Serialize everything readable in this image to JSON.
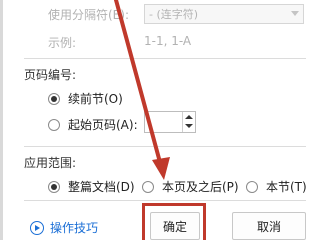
{
  "separator_setting": {
    "label": "使用分隔符(E):",
    "value": "- (连字符)",
    "example_label": "示例:",
    "example_value": "1-1, 1-A"
  },
  "page_numbering": {
    "title": "页码编号:",
    "continue_label": "续前节(O)",
    "start_label": "起始页码(A):",
    "start_value": "",
    "selected": "continue"
  },
  "apply_scope": {
    "title": "应用范围:",
    "options": [
      "整篇文档(D)",
      "本页及之后(P)",
      "本节(T)"
    ],
    "selected": "整篇文档(D)"
  },
  "footer": {
    "tips_label": "操作技巧",
    "ok_label": "确定",
    "cancel_label": "取消"
  },
  "colors": {
    "annotation": "#c0392b",
    "link": "#1b6fd6",
    "disabled_text": "#b2b2b2"
  }
}
